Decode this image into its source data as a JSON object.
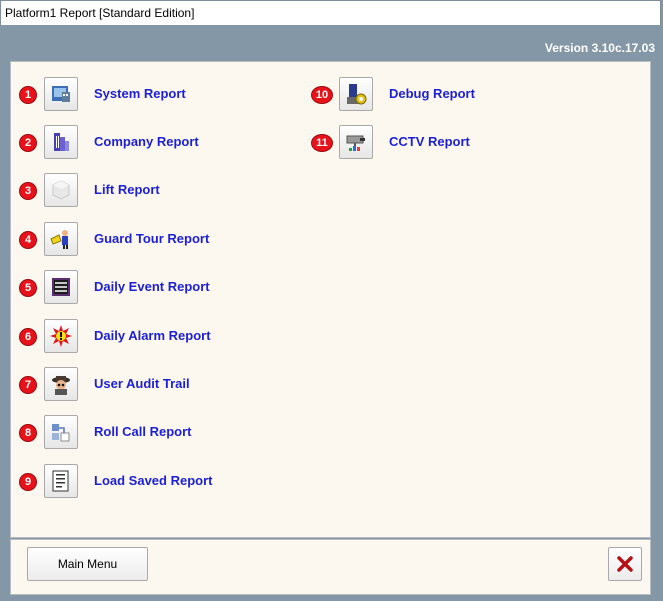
{
  "window": {
    "title": "Platform1 Report [Standard Edition]"
  },
  "header": {
    "version": "Version 3.10c.17.03"
  },
  "left_items": [
    {
      "number": "1",
      "label": "System Report",
      "icon": "system-report-icon"
    },
    {
      "number": "2",
      "label": "Company Report",
      "icon": "company-report-icon"
    },
    {
      "number": "3",
      "label": "Lift Report",
      "icon": "lift-report-icon"
    },
    {
      "number": "4",
      "label": "Guard Tour Report",
      "icon": "guard-tour-icon"
    },
    {
      "number": "5",
      "label": "Daily Event Report",
      "icon": "daily-event-icon"
    },
    {
      "number": "6",
      "label": "Daily Alarm Report",
      "icon": "daily-alarm-icon"
    },
    {
      "number": "7",
      "label": "User Audit Trail",
      "icon": "user-audit-icon"
    },
    {
      "number": "8",
      "label": "Roll Call Report",
      "icon": "roll-call-icon"
    },
    {
      "number": "9",
      "label": "Load Saved Report",
      "icon": "load-saved-icon"
    }
  ],
  "right_items": [
    {
      "number": "10",
      "label": "Debug Report",
      "icon": "debug-report-icon"
    },
    {
      "number": "11",
      "label": "CCTV Report",
      "icon": "cctv-report-icon"
    }
  ],
  "footer": {
    "main_menu_label": "Main Menu",
    "close_icon": "close-x-icon"
  },
  "colors": {
    "accent_link": "#1b1fd6",
    "badge": "#e8121a",
    "frame": "#8497a7",
    "panel": "#fdf8ef"
  }
}
